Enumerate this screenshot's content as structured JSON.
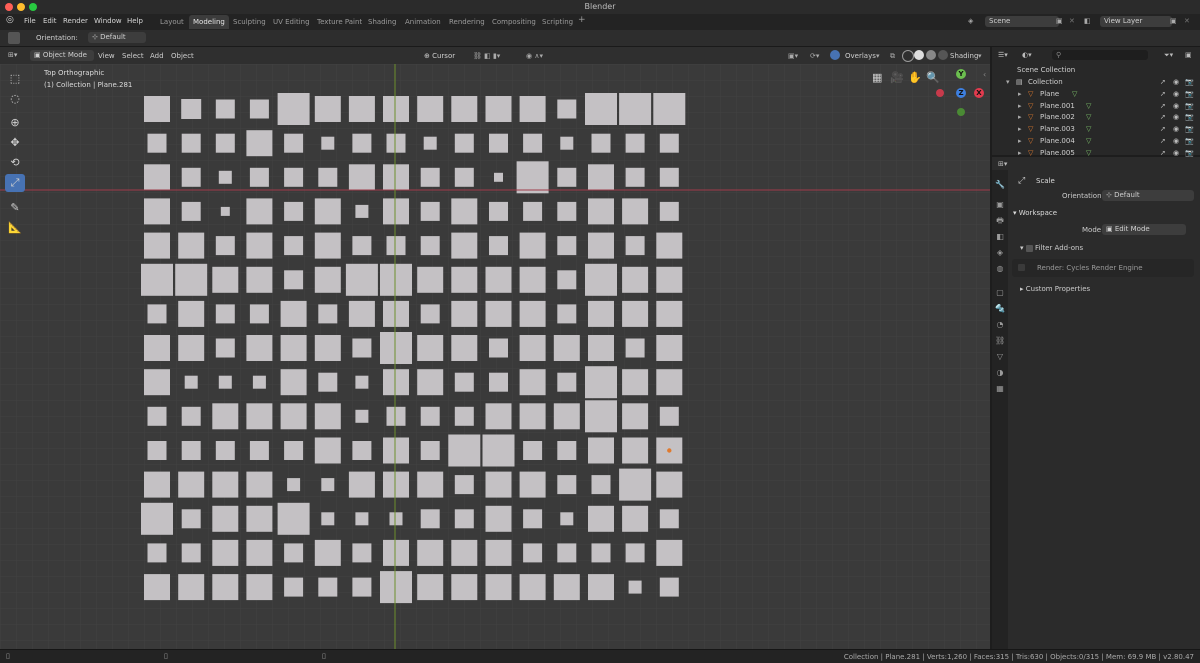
{
  "window": {
    "title": "Blender"
  },
  "menu": [
    "File",
    "Edit",
    "Render",
    "Window",
    "Help"
  ],
  "workspaces": [
    "Layout",
    "Modeling",
    "Sculpting",
    "UV Editing",
    "Texture Paint",
    "Shading",
    "Animation",
    "Rendering",
    "Compositing",
    "Scripting"
  ],
  "active_workspace": "Modeling",
  "scene": {
    "scene_name": "Scene",
    "view_layer": "View Layer"
  },
  "tool_settings": {
    "orientation_label": "Orientation:",
    "orientation_value": "Default"
  },
  "viewport_header": {
    "mode": "Object Mode",
    "menus": [
      "View",
      "Select",
      "Add",
      "Object"
    ],
    "pivot": "Cursor",
    "overlays": "Overlays",
    "shading": "Shading"
  },
  "viewport": {
    "view_name": "Top Orthographic",
    "context": "(1) Collection | Plane.281",
    "gizmo": {
      "y": "Y",
      "z": "Z",
      "x": "X"
    }
  },
  "outliner": {
    "root": "Scene Collection",
    "collection": "Collection",
    "objects": [
      "Plane",
      "Plane.001",
      "Plane.002",
      "Plane.003",
      "Plane.004",
      "Plane.005"
    ]
  },
  "properties": {
    "tool_name": "Scale",
    "orientation_label": "Orientation",
    "orientation_value": "Default",
    "workspace_panel": "Workspace",
    "mode_label": "Mode",
    "mode_value": "Edit Mode",
    "filter_addons": "Filter Add-ons",
    "render_engine": "Render: Cycles Render Engine",
    "custom_properties": "Custom Properties"
  },
  "status_bar": "Collection | Plane.281 | Verts:1,260 | Faces:315 | Tris:630 | Objects:0/315 | Mem: 69.9 MB | v2.80.47",
  "grid": {
    "size_codes": [
      "4633544444443555",
      "3334323323332333",
      "4323334433153433",
      "4314342434333443",
      "4434343334343434",
      "5544345544443544",
      "3433434434443444",
      "4434443544344434",
      "4222432443343544",
      "3344442333444543",
      "3333343435533444",
      "4444224443443354",
      "5344522233432443",
      "3344343444433334",
      "4444333544444423"
    ],
    "highlighted_square": {
      "row": 10,
      "col": 15
    }
  },
  "colors": {
    "square": "#c4c1c4",
    "accent": "#4772b3",
    "orange": "#e07a2e",
    "green": "#6cbf4f"
  }
}
